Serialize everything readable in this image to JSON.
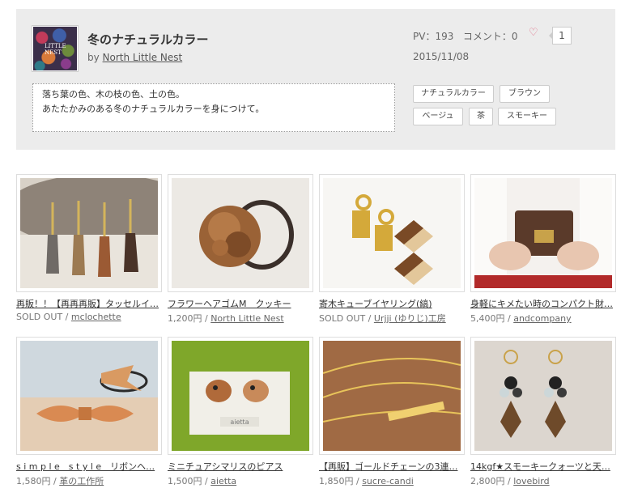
{
  "collection": {
    "title": "冬のナチュラルカラー",
    "by_prefix": "by ",
    "author": "North Little Nest",
    "thumb_text": "LITTLE NEST",
    "pv_label": "PV：193",
    "comment_label": "コメント：0",
    "like_count": "1",
    "date": "2015/11/08",
    "description": [
      "落ち葉の色、木の枝の色、土の色。",
      "あたたかみのある冬のナチュラルカラーを身につけて。"
    ],
    "tags": [
      "ナチュラルカラー",
      "ブラウン",
      "ベージュ",
      "茶",
      "スモーキー"
    ]
  },
  "items": [
    {
      "title": "再販！！【再再再販】タッセルイ…",
      "price": "SOLD OUT",
      "shop": "mclochette"
    },
    {
      "title": "フラワーヘアゴムM　クッキー",
      "price": "1,200円",
      "shop": "North Little Nest"
    },
    {
      "title": "寄木キューブイヤリング(縞)",
      "price": "SOLD OUT",
      "shop": "Urjji (ゆりじ)工房"
    },
    {
      "title": "身軽にキメたい時のコンパクト財…",
      "price": "5,400円",
      "shop": "andcompany"
    },
    {
      "title": "s i m p l e　s t y l e　リボンヘ…",
      "price": "1,580円",
      "shop": "革の工作所"
    },
    {
      "title": "ミニチュアシマリスのピアス",
      "price": "1,500円",
      "shop": "aietta"
    },
    {
      "title": "【再販】ゴールドチェーンの3連…",
      "price": "1,850円",
      "shop": "sucre-candi"
    },
    {
      "title": "14kgf★スモーキークォーツと天…",
      "price": "2,800円",
      "shop": "lovebird"
    }
  ],
  "card_label_aietta": "aietta",
  "icons": {
    "heart": "heart-icon"
  },
  "colors": {
    "header_bg": "#ececec",
    "heart": "#e06a82"
  }
}
